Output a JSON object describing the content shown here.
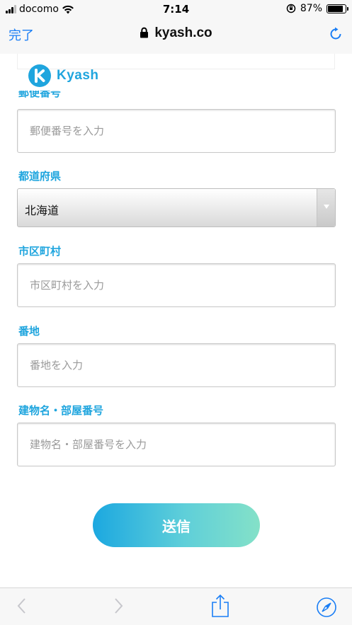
{
  "status_bar": {
    "carrier": "docomo",
    "time": "7:14",
    "battery": "87%",
    "battery_level": 0.87
  },
  "browser": {
    "done_label": "完了",
    "url": "kyash.co"
  },
  "brand": {
    "name": "Kyash",
    "color": "#1fa5de"
  },
  "form": {
    "postal": {
      "label": "郵便番号",
      "placeholder": "郵便番号を入力"
    },
    "prefecture": {
      "label": "都道府県",
      "selected": "北海道"
    },
    "city": {
      "label": "市区町村",
      "placeholder": "市区町村を入力"
    },
    "address": {
      "label": "番地",
      "placeholder": "番地を入力"
    },
    "building": {
      "label": "建物名・部屋番号",
      "placeholder": "建物名・部屋番号を入力"
    },
    "submit_label": "送信"
  },
  "icons": [
    "wifi-icon",
    "lock-icon",
    "reload-icon",
    "back-icon",
    "forward-icon",
    "share-icon",
    "compass-icon"
  ]
}
